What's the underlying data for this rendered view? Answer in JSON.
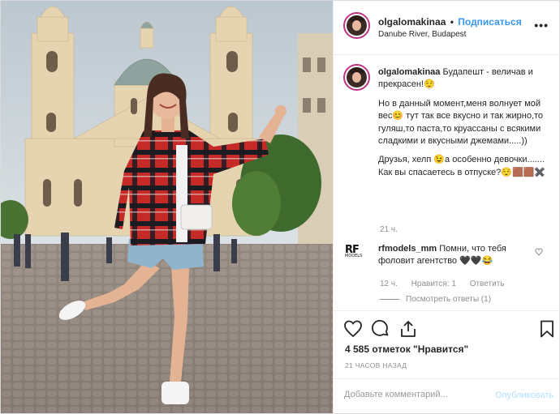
{
  "post": {
    "username": "olgalomakinaa",
    "separator": "•",
    "follow_label": "Подписаться",
    "location": "Danube River, Budapest",
    "more_label": "•••"
  },
  "caption": {
    "username": "olgalomakinaa",
    "p1": "Будапешт - величав и прекрасен!😌",
    "p2": "Но в данный момент,меня волнует мой вес😊 тут так все вкусно и так жирно,то гуляш,то паста,то круассаны с всякими сладкими и вкусными джемами.....))",
    "p3": "Друзья, хелп 😉а особенно девочки.......\nКак вы спасаетесь в отпуске?😌🟫🟫✖️",
    "time": "21 ч."
  },
  "comment": {
    "logo_text": "RF",
    "logo_sub": "MODELS",
    "username": "rfmodels_mm",
    "text": "Помни, что тебя фоловит агентство 🖤🖤😂",
    "time": "12 ч.",
    "likes": "Нравится: 1",
    "reply": "Ответить",
    "view_replies": "Посмотреть ответы (1)"
  },
  "actions": {
    "likes_count": "4 585 отметок \"Нравится\"",
    "posted_time": "21 ЧАСОВ НАЗАД"
  },
  "add_comment": {
    "placeholder": "Добавьте комментарий...",
    "publish_label": "Опубликовать"
  },
  "colors": {
    "link_blue": "#3897f0",
    "publish_disabled": "#b2dffc",
    "muted_text": "#8e8e8e",
    "border": "#efefef"
  }
}
